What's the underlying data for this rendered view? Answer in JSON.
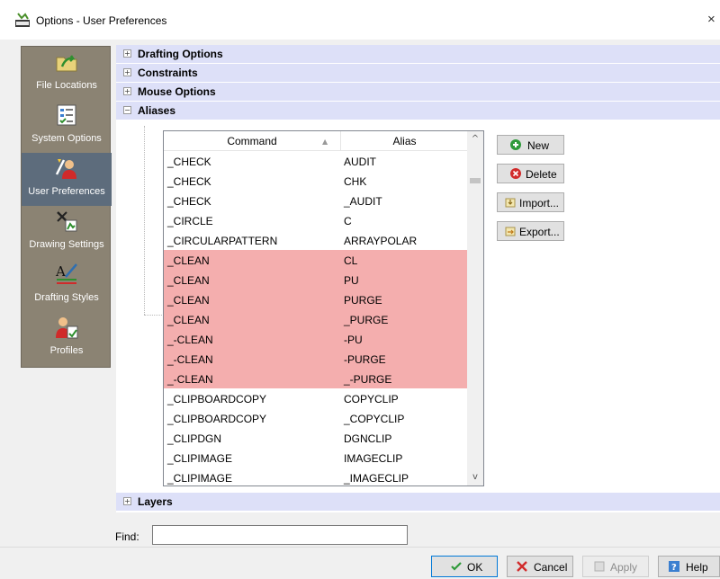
{
  "window": {
    "title": "Options - User Preferences",
    "close_glyph": "×",
    "accent_color": "#0078d7"
  },
  "sidebar": {
    "items": [
      {
        "label": "File Locations",
        "icon": "folder-arrow-icon"
      },
      {
        "label": "System Options",
        "icon": "checklist-icon"
      },
      {
        "label": "User Preferences",
        "icon": "user-preferences-icon",
        "selected": true
      },
      {
        "label": "Drawing Settings",
        "icon": "drawing-settings-icon"
      },
      {
        "label": "Drafting Styles",
        "icon": "drafting-styles-icon"
      },
      {
        "label": "Profiles",
        "icon": "profiles-icon"
      }
    ]
  },
  "tree": {
    "sections": [
      {
        "label": "Drafting Options",
        "expander": "+"
      },
      {
        "label": "Constraints",
        "expander": "+"
      },
      {
        "label": "Mouse Options",
        "expander": "+"
      },
      {
        "label": "Aliases",
        "expander": "−"
      }
    ],
    "last_section": {
      "label": "Layers",
      "expander": "+"
    }
  },
  "aliases_grid": {
    "columns": {
      "command": "Command",
      "alias": "Alias"
    },
    "sort_glyph": "▲",
    "scroll_up": "^",
    "scroll_down": "v",
    "highlight_color": "#f4aeae",
    "rows": [
      {
        "command": "_CHECK",
        "alias": "AUDIT",
        "highlighted": false
      },
      {
        "command": "_CHECK",
        "alias": "CHK",
        "highlighted": false
      },
      {
        "command": "_CHECK",
        "alias": "_AUDIT",
        "highlighted": false
      },
      {
        "command": "_CIRCLE",
        "alias": "C",
        "highlighted": false
      },
      {
        "command": "_CIRCULARPATTERN",
        "alias": "ARRAYPOLAR",
        "highlighted": false
      },
      {
        "command": "_CLEAN",
        "alias": "CL",
        "highlighted": true
      },
      {
        "command": "_CLEAN",
        "alias": "PU",
        "highlighted": true
      },
      {
        "command": "_CLEAN",
        "alias": "PURGE",
        "highlighted": true
      },
      {
        "command": "_CLEAN",
        "alias": "_PURGE",
        "highlighted": true
      },
      {
        "command": "_-CLEAN",
        "alias": "-PU",
        "highlighted": true
      },
      {
        "command": "_-CLEAN",
        "alias": "-PURGE",
        "highlighted": true
      },
      {
        "command": "_-CLEAN",
        "alias": "_-PURGE",
        "highlighted": true
      },
      {
        "command": "_CLIPBOARDCOPY",
        "alias": "COPYCLIP",
        "highlighted": false
      },
      {
        "command": "_CLIPBOARDCOPY",
        "alias": "_COPYCLIP",
        "highlighted": false
      },
      {
        "command": "_CLIPDGN",
        "alias": "DGNCLIP",
        "highlighted": false
      },
      {
        "command": "_CLIPIMAGE",
        "alias": "IMAGECLIP",
        "highlighted": false
      },
      {
        "command": "_CLIPIMAGE",
        "alias": "_IMAGECLIP",
        "highlighted": false
      }
    ]
  },
  "side_buttons": {
    "new": "New",
    "delete": "Delete",
    "import": "Import...",
    "export": "Export..."
  },
  "find": {
    "label": "Find:",
    "value": "",
    "placeholder": ""
  },
  "footer": {
    "ok": "OK",
    "cancel": "Cancel",
    "apply": "Apply",
    "help": "Help"
  }
}
